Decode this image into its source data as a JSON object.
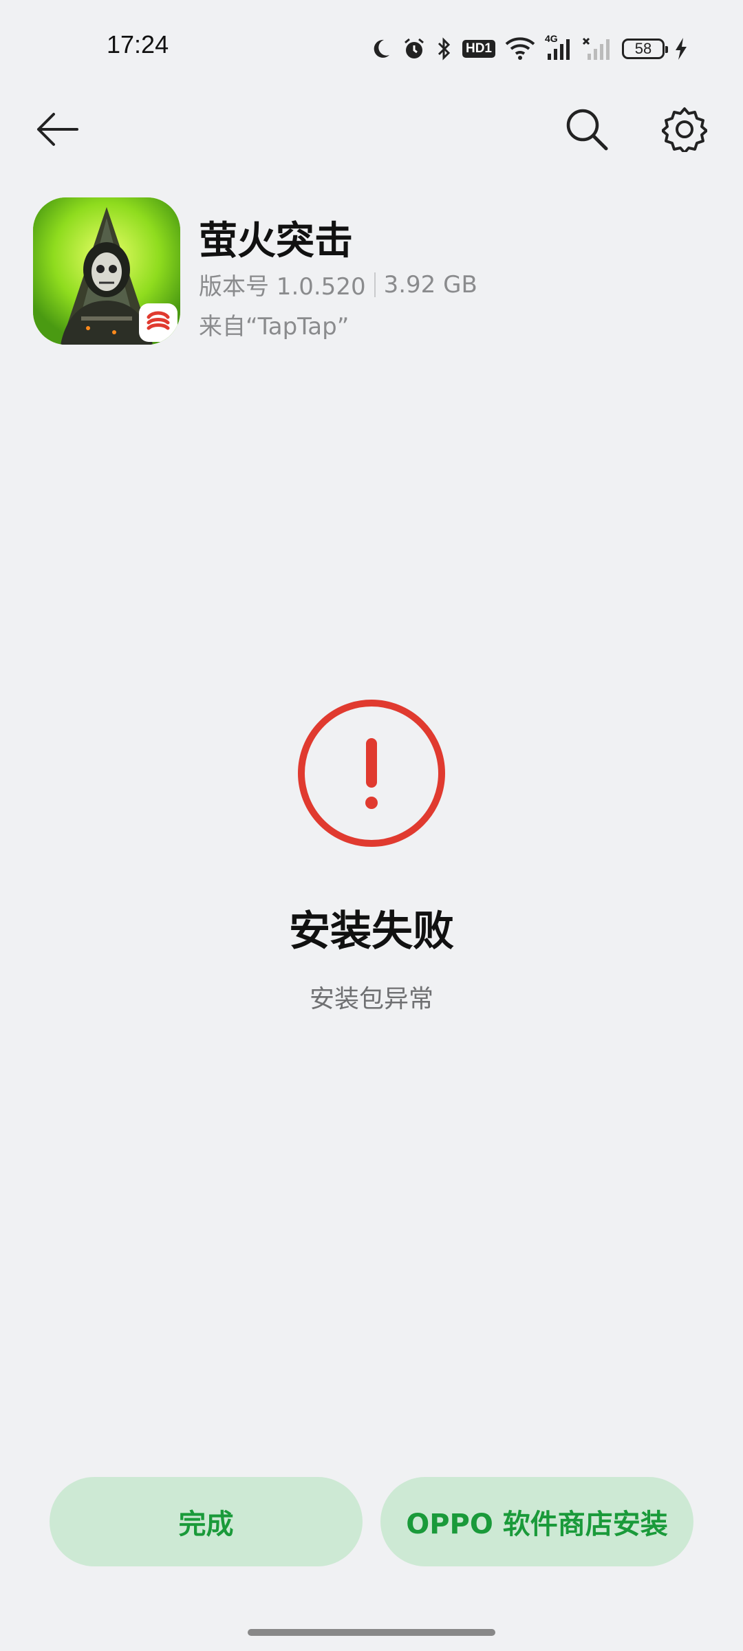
{
  "status_bar": {
    "time": "17:24",
    "icons": [
      "moon-icon",
      "alarm-icon",
      "bluetooth-icon",
      "hd-icon",
      "wifi-icon",
      "signal-4g-icon",
      "signal-no-service-icon",
      "battery-icon",
      "charging-icon"
    ],
    "hd_label": "HD1",
    "network_label": "4G",
    "battery_level": "58"
  },
  "top_nav": {
    "icons": [
      "back-arrow-icon",
      "search-icon",
      "gear-icon"
    ]
  },
  "app": {
    "name": "萤火突击",
    "version": "版本号 1.0.520",
    "size": "3.92 GB",
    "source": "来自“TapTap”"
  },
  "result": {
    "icon": "error-exclamation-icon",
    "title": "安装失败",
    "reason": "安装包异常"
  },
  "actions": {
    "done_label": "完成",
    "store_label": "OPPO 软件商店安装"
  },
  "colors": {
    "background": "#f0f1f3",
    "error_red": "#e03a2f",
    "button_bg": "#cde9d4",
    "button_text": "#1a9a3a",
    "secondary_text": "#8a8b8d"
  }
}
